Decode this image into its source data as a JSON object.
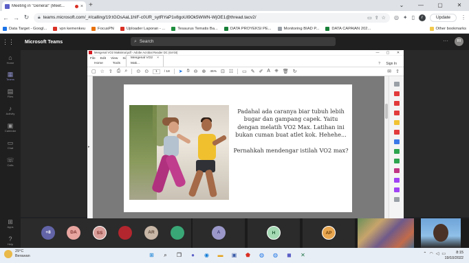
{
  "browser": {
    "tab_title": "Meeting in \"General\" (Meet...",
    "tab_close": "×",
    "new_tab": "+",
    "window_controls": [
      "⌄",
      "—",
      "▢",
      "✕"
    ],
    "url": "teams.microsoft.com/_#/calling/19:tGOsAaL1hIF-c0UR_sytRYaP1v8goUi9Ok5WWN-WjOE1@thread.tacv2/",
    "profile_initial": "r",
    "update_label": "Update",
    "bookmarks": [
      {
        "label": "Data Target - Googl...",
        "color": "#1a73e8"
      },
      {
        "label": "vpn kemenkeu",
        "color": "#d93025"
      },
      {
        "label": "FocusPN",
        "color": "#e8710a"
      },
      {
        "label": "Uploader Laporan - ...",
        "color": "#d93025"
      },
      {
        "label": "Tesaurus Tematis Ba...",
        "color": "#1e8e3e"
      },
      {
        "label": "DATA PROYEKSI PE...",
        "color": "#188038"
      },
      {
        "label": "Monitoring BIAD P...",
        "color": "#9aa0a6"
      },
      {
        "label": "DATA CAPAIAN 202...",
        "color": "#188038"
      }
    ],
    "other_bookmarks": "Other bookmarks"
  },
  "teams": {
    "brand": "Microsoft Teams",
    "search_placeholder": "Search",
    "user_initials": "RI",
    "rail": [
      {
        "label": "Home",
        "icon": "home-icon",
        "glyph": "⌂"
      },
      {
        "label": "Teams",
        "icon": "teams-icon",
        "glyph": "▦"
      },
      {
        "label": "Files",
        "icon": "files-icon",
        "glyph": "▤"
      },
      {
        "label": "Activity",
        "icon": "bell-icon",
        "glyph": "♪"
      },
      {
        "label": "Calendar",
        "icon": "calendar-icon",
        "glyph": "▣"
      },
      {
        "label": "Chat",
        "icon": "chat-icon",
        "glyph": "▭"
      },
      {
        "label": "Calls",
        "icon": "phone-icon",
        "glyph": "☏"
      },
      {
        "label": "Apps",
        "icon": "apps-icon",
        "glyph": "⊞"
      },
      {
        "label": "Help",
        "icon": "help-icon",
        "glyph": "?"
      }
    ]
  },
  "acrobat": {
    "window_title": "Mengenal VO2 Maksimal.pdf - Adobe Acrobat Reader DC (64-bit)",
    "menu": [
      "File",
      "Edit",
      "View",
      "Sign",
      "Window",
      "Help"
    ],
    "tabs": [
      "Home",
      "Tools"
    ],
    "doc_tab": "Mengenal VO2 Mak...",
    "sign_in": "Sign In",
    "page_current": "1",
    "page_total": "/ 18",
    "zoom": "45%"
  },
  "slide": {
    "paragraph1": "Padahal ada caranya biar tubuh lebih bugar dan gampang capek. Yaitu dengan melatih VO2 Max. Latihan ini bukan cuman buat atlet kok.  Hehehe...",
    "paragraph2": "Pernahkah mendengar istilah VO2 max?"
  },
  "participants": [
    {
      "initials": "+8",
      "color": "#6264a7"
    },
    {
      "initials": "DA",
      "color": "#e8a5a0"
    },
    {
      "initials": "SS",
      "color": "#d99f9b"
    },
    {
      "initials": "",
      "color": "#b3262e"
    },
    {
      "initials": "AR",
      "color": "#c8b6a6"
    },
    {
      "initials": "",
      "color": "#3aa776"
    },
    {
      "initials": "A",
      "color": "#9b98c9"
    },
    {
      "initials": "H",
      "color": "#a4d9b4"
    },
    {
      "initials": "AP",
      "color": "#e8a64f"
    }
  ],
  "taskbar": {
    "temperature": "29°C",
    "weather": "Berawan",
    "time": "8:15",
    "date": "19/10/2022"
  }
}
